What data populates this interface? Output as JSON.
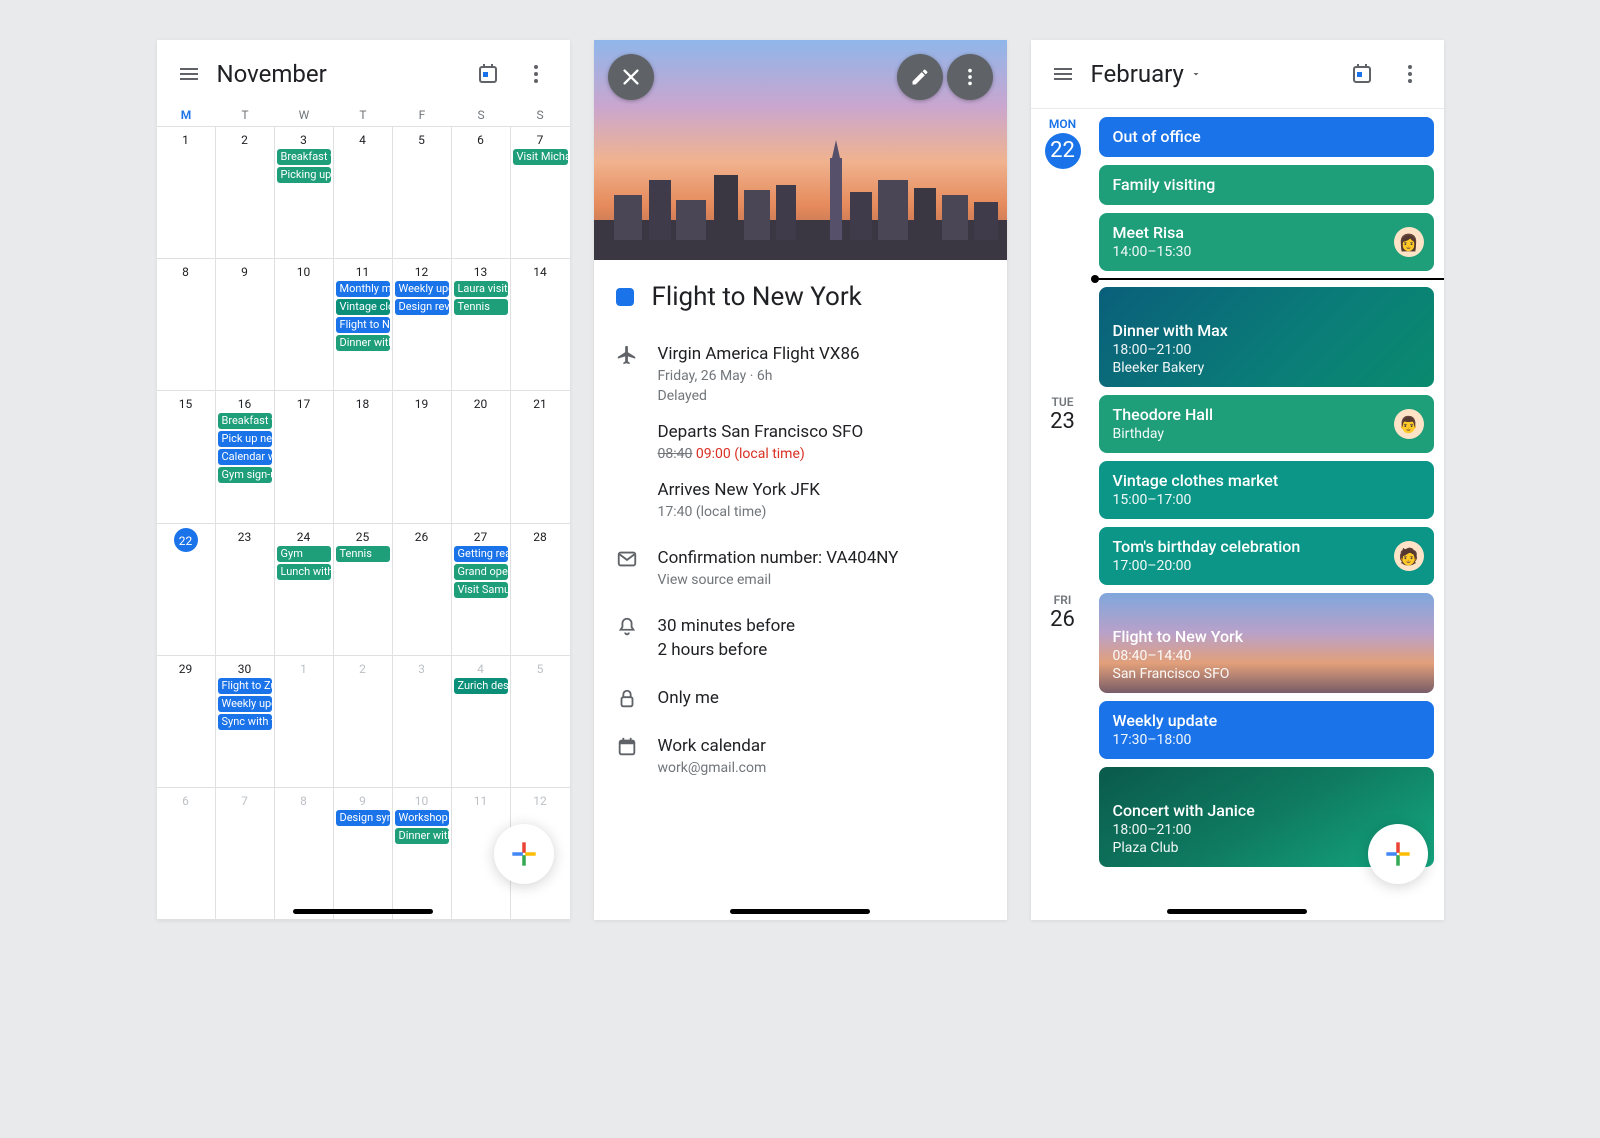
{
  "colors": {
    "blue": "#1a73e8",
    "green": "#1e9e79",
    "teal": "#0b9687"
  },
  "monthView": {
    "title": "November",
    "weekdays": [
      "M",
      "T",
      "W",
      "T",
      "F",
      "S",
      "S"
    ],
    "todayWeekdayIndex": 0,
    "todayDate": 22,
    "weeks": [
      {
        "days": [
          {
            "n": 1
          },
          {
            "n": 2
          },
          {
            "n": 3,
            "events": [
              {
                "label": "Breakfast w",
                "color": "green"
              },
              {
                "label": "Picking up",
                "color": "green"
              }
            ]
          },
          {
            "n": 4
          },
          {
            "n": 5
          },
          {
            "n": 6
          },
          {
            "n": 7,
            "events": [
              {
                "label": "Visit Micha",
                "color": "green"
              }
            ]
          }
        ]
      },
      {
        "days": [
          {
            "n": 8
          },
          {
            "n": 9
          },
          {
            "n": 10
          },
          {
            "n": 11,
            "events": [
              {
                "label": "Monthly me",
                "color": "blue"
              },
              {
                "label": "Vintage clo",
                "color": "teal"
              },
              {
                "label": "Flight to Ne",
                "color": "blue"
              },
              {
                "label": "Dinner with",
                "color": "green"
              }
            ]
          },
          {
            "n": 12,
            "events": [
              {
                "label": "Weekly upd",
                "color": "blue"
              },
              {
                "label": "Design revi",
                "color": "blue"
              }
            ]
          },
          {
            "n": 13,
            "events": [
              {
                "label": "Laura visiti",
                "color": "green"
              },
              {
                "label": "Tennis",
                "color": "green"
              }
            ]
          },
          {
            "n": 14
          }
        ]
      },
      {
        "days": [
          {
            "n": 15
          },
          {
            "n": 16,
            "events": [
              {
                "label": "Breakfast w",
                "color": "green"
              },
              {
                "label": "Pick up nev",
                "color": "blue"
              },
              {
                "label": "Calendar w",
                "color": "blue"
              },
              {
                "label": "Gym sign-u",
                "color": "green"
              }
            ]
          },
          {
            "n": 17
          },
          {
            "n": 18
          },
          {
            "n": 19
          },
          {
            "n": 20
          },
          {
            "n": 21
          }
        ]
      },
      {
        "days": [
          {
            "n": 22,
            "today": true
          },
          {
            "n": 23
          },
          {
            "n": 24,
            "events": [
              {
                "label": "Gym",
                "color": "green"
              },
              {
                "label": "Lunch with",
                "color": "green"
              }
            ]
          },
          {
            "n": 25,
            "events": [
              {
                "label": "Tennis",
                "color": "green"
              }
            ]
          },
          {
            "n": 26
          },
          {
            "n": 27,
            "events": [
              {
                "label": "Getting rea",
                "color": "blue"
              },
              {
                "label": "Grand open",
                "color": "green"
              },
              {
                "label": "Visit Samue",
                "color": "green"
              }
            ]
          },
          {
            "n": 28
          }
        ]
      },
      {
        "days": [
          {
            "n": 29
          },
          {
            "n": 30,
            "events": [
              {
                "label": "Flight to Zu",
                "color": "blue"
              },
              {
                "label": "Weekly upd",
                "color": "blue"
              },
              {
                "label": "Sync with t",
                "color": "blue"
              }
            ]
          },
          {
            "n": 1,
            "other": true
          },
          {
            "n": 2,
            "other": true
          },
          {
            "n": 3,
            "other": true
          },
          {
            "n": 4,
            "other": true,
            "events": [
              {
                "label": "Zurich desi",
                "color": "teal"
              }
            ]
          },
          {
            "n": 5,
            "other": true
          }
        ]
      },
      {
        "days": [
          {
            "n": 6,
            "other": true
          },
          {
            "n": 7,
            "other": true
          },
          {
            "n": 8,
            "other": true
          },
          {
            "n": 9,
            "other": true,
            "events": [
              {
                "label": "Design syn",
                "color": "blue"
              }
            ]
          },
          {
            "n": 10,
            "other": true,
            "events": [
              {
                "label": "Workshop",
                "color": "blue"
              },
              {
                "label": "Dinner with",
                "color": "green"
              }
            ]
          },
          {
            "n": 11,
            "other": true
          },
          {
            "n": 12,
            "other": true
          }
        ]
      }
    ]
  },
  "eventDetail": {
    "title": "Flight to New York",
    "flight": {
      "heading": "Virgin America Flight VX86",
      "dateline": "Friday, 26 May  ·  6h",
      "status": "Delayed",
      "dep_title": "Departs San Francisco SFO",
      "dep_old": "08:40",
      "dep_new": "09:00 (local time)",
      "arr_title": "Arrives New York JFK",
      "arr_time": "17:40 (local time)"
    },
    "confirmation": {
      "line1": "Confirmation number: VA404NY",
      "line2": "View source email"
    },
    "reminders": {
      "r1": "30 minutes before",
      "r2": "2 hours before"
    },
    "visibility": "Only me",
    "calendar": {
      "name": "Work calendar",
      "account": "work@gmail.com"
    }
  },
  "scheduleView": {
    "title": "February",
    "days": [
      {
        "dow": "MON",
        "num": "22",
        "today": true,
        "cards": [
          {
            "title": "Out of office",
            "style": "blue"
          },
          {
            "title": "Family visiting",
            "style": "green"
          },
          {
            "title": "Meet Risa",
            "sub": "14:00–15:30",
            "style": "green",
            "avatar": "👩"
          },
          {
            "__now__": true
          },
          {
            "title": "Dinner with Max",
            "sub": "18:00–21:00",
            "sub2": "Bleeker Bakery",
            "style": "dinner",
            "tall": true
          }
        ]
      },
      {
        "dow": "TUE",
        "num": "23",
        "cards": [
          {
            "title": "Theodore Hall",
            "sub": "Birthday",
            "style": "green",
            "avatar": "👨"
          },
          {
            "title": "Vintage clothes market",
            "sub": "15:00–17:00",
            "style": "teal"
          },
          {
            "title": "Tom's birthday celebration",
            "sub": "17:00–20:00",
            "style": "teal",
            "avatar": "🧑"
          }
        ]
      },
      {
        "dow": "FRI",
        "num": "26",
        "cards": [
          {
            "title": "Flight to New York",
            "sub": "08:40–14:40",
            "sub2": "San Francisco SFO",
            "style": "flight",
            "tall": true
          },
          {
            "title": "Weekly update",
            "sub": "17:30–18:00",
            "style": "blue"
          },
          {
            "title": "Concert with Janice",
            "sub": "18:00–21:00",
            "sub2": "Plaza Club",
            "style": "concert",
            "tall": true
          }
        ]
      }
    ]
  }
}
